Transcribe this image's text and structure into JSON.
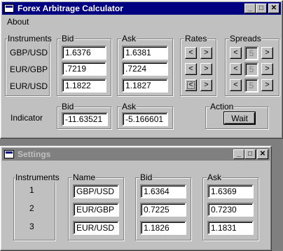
{
  "main_window": {
    "title": "Forex Arbitrage Calculator",
    "menu": [
      "About"
    ],
    "instruments_label": "Instruments",
    "bid_label": "Bid",
    "ask_label": "Ask",
    "rates_label": "Rates",
    "spreads_label": "Spreads",
    "pairs": [
      {
        "name": "GBP/USD",
        "bid": "1.6376",
        "ask": "1.6381",
        "spread": "5"
      },
      {
        "name": "EUR/GBP",
        "bid": ".7219",
        "ask": ".7224",
        "spread": "5"
      },
      {
        "name": "EUR/USD",
        "bid": "1.1822",
        "ask": "1.1827",
        "spread": "5"
      }
    ],
    "indicator_label": "Indicator",
    "indicator_bid_label": "Bid",
    "indicator_ask_label": "Ask",
    "indicator_bid": "-11.63521",
    "indicator_ask": "-5.166601",
    "action_label": "Action",
    "action_button": "Wait",
    "left_arrow": "<",
    "right_arrow": ">"
  },
  "settings_window": {
    "title": "Settings",
    "instruments_label": "Instruments",
    "name_label": "Name",
    "bid_label": "Bid",
    "ask_label": "Ask",
    "rows": [
      {
        "index": "1",
        "name": "GBP/USD",
        "bid": "1.6364",
        "ask": "1.6369"
      },
      {
        "index": "2",
        "name": "EUR/GBP",
        "bid": "0.7225",
        "ask": "0.7230"
      },
      {
        "index": "3",
        "name": "EUR/USD",
        "bid": "1.1826",
        "ask": "1.1831"
      }
    ]
  },
  "titlebar_buttons": {
    "minimize": "_",
    "maximize": "□",
    "close": "✕"
  }
}
